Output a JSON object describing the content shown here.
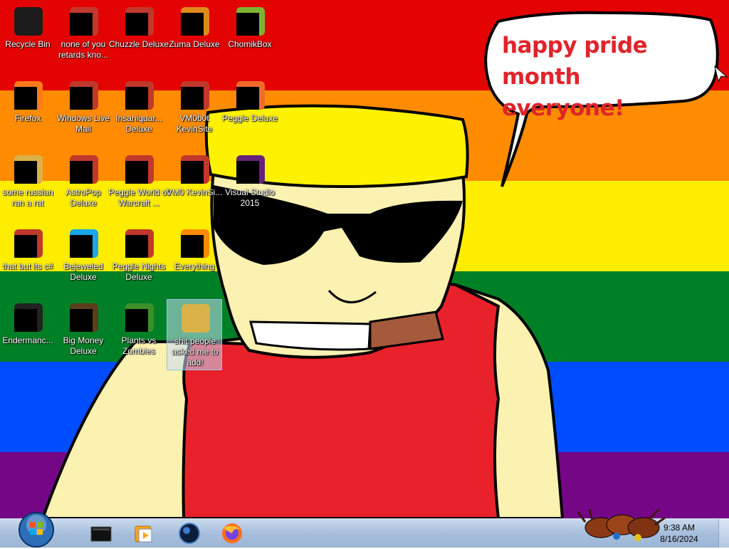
{
  "desktop": {
    "speech_bubble": {
      "line1": "happy pride month",
      "line2": "everyone!"
    },
    "icons": [
      {
        "label": "Recycle Bin",
        "icon": "recycle-bin-icon",
        "masked": false
      },
      {
        "label": "none of you retards kno...",
        "icon": "shortcut-icon",
        "masked": true
      },
      {
        "label": "Chuzzle Deluxe",
        "icon": "chuzzle-icon",
        "masked": true
      },
      {
        "label": "Zuma Deluxe",
        "icon": "zuma-icon",
        "masked": true
      },
      {
        "label": "ChomikBox",
        "icon": "chomikbox-icon",
        "masked": true
      },
      {
        "label": "Firefox",
        "icon": "firefox-icon",
        "masked": true
      },
      {
        "label": "Windows Live Mail",
        "icon": "mail-icon",
        "masked": true
      },
      {
        "label": "Insaniquar... Deluxe",
        "icon": "insaniquarium-icon",
        "masked": true
      },
      {
        "label": "VM0b0t KevinSite",
        "icon": "vm-icon",
        "masked": true
      },
      {
        "label": "Peggle Deluxe",
        "icon": "peggle-icon",
        "masked": true
      },
      {
        "label": "some russian ran a rat",
        "icon": "folder-icon",
        "masked": true
      },
      {
        "label": "AstroPop Deluxe",
        "icon": "astropop-icon",
        "masked": true
      },
      {
        "label": "Peggle World of Warcraft ...",
        "icon": "peggle-wow-icon",
        "masked": true
      },
      {
        "label": "VM0 KevinSi...",
        "icon": "vm-icon",
        "masked": true
      },
      {
        "label": "Visual Studio 2015",
        "icon": "visual-studio-icon",
        "masked": true
      },
      {
        "label": "that but its c#",
        "icon": "shortcut-icon",
        "masked": true
      },
      {
        "label": "Bejeweled Deluxe",
        "icon": "bejeweled-icon",
        "masked": true
      },
      {
        "label": "Peggle Nights Deluxe",
        "icon": "peggle-nights-icon",
        "masked": true
      },
      {
        "label": "Everything",
        "icon": "everything-icon",
        "masked": true
      },
      {
        "label": "Endermanc...",
        "icon": "console-icon",
        "masked": true
      },
      {
        "label": "Big Money Deluxe",
        "icon": "big-money-icon",
        "masked": true
      },
      {
        "label": "Plants vs Zombies",
        "icon": "pvz-icon",
        "masked": true
      },
      {
        "label": "shit people asked me to add!",
        "icon": "folder-icon",
        "masked": false,
        "selected": true
      }
    ]
  },
  "taskbar": {
    "start": "start-orb-icon",
    "pinned": [
      {
        "icon": "terminal-icon"
      },
      {
        "icon": "media-player-icon"
      },
      {
        "icon": "globe-icon"
      },
      {
        "icon": "firefox-icon"
      }
    ],
    "clock": {
      "time": "9:38 AM",
      "date": "8/16/2024"
    }
  },
  "colors": {
    "rainbow": [
      "#e40303",
      "#ff8c00",
      "#ffed00",
      "#008026",
      "#004dff",
      "#750787"
    ],
    "bubble_text": "#e0242b",
    "skin": "#fbf1b1",
    "hair": "#fff200",
    "shirt": "#e8212a",
    "cigar": "#a55a3c"
  }
}
